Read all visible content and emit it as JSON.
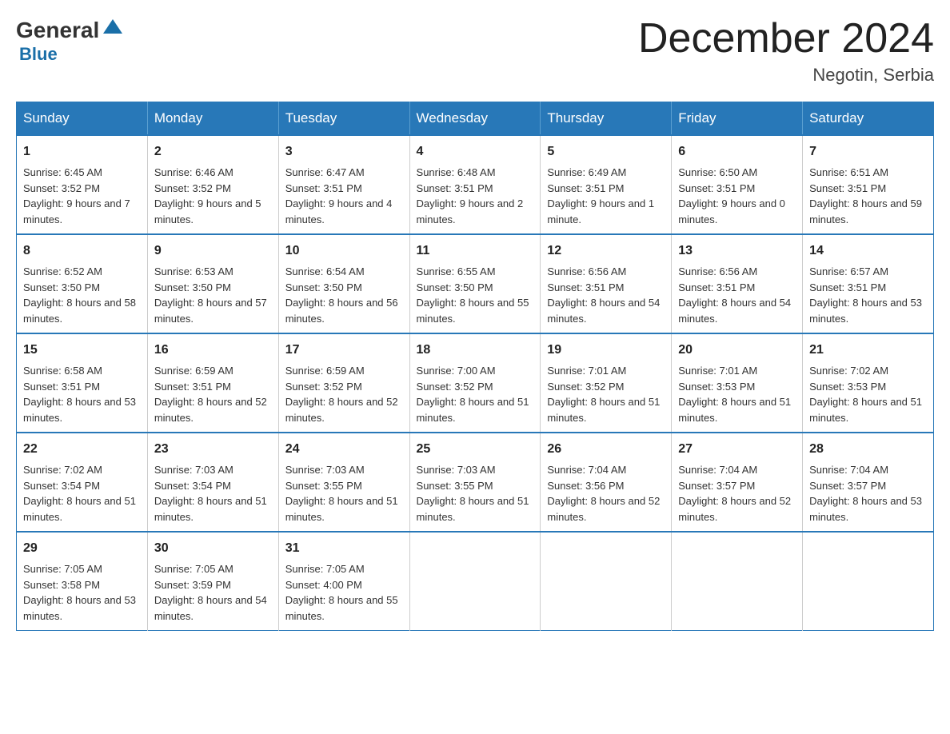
{
  "header": {
    "logo": {
      "general": "General",
      "blue": "Blue"
    },
    "month_title": "December 2024",
    "location": "Negotin, Serbia"
  },
  "days_of_week": [
    "Sunday",
    "Monday",
    "Tuesday",
    "Wednesday",
    "Thursday",
    "Friday",
    "Saturday"
  ],
  "weeks": [
    [
      {
        "day": "1",
        "sunrise": "6:45 AM",
        "sunset": "3:52 PM",
        "daylight": "9 hours and 7 minutes."
      },
      {
        "day": "2",
        "sunrise": "6:46 AM",
        "sunset": "3:52 PM",
        "daylight": "9 hours and 5 minutes."
      },
      {
        "day": "3",
        "sunrise": "6:47 AM",
        "sunset": "3:51 PM",
        "daylight": "9 hours and 4 minutes."
      },
      {
        "day": "4",
        "sunrise": "6:48 AM",
        "sunset": "3:51 PM",
        "daylight": "9 hours and 2 minutes."
      },
      {
        "day": "5",
        "sunrise": "6:49 AM",
        "sunset": "3:51 PM",
        "daylight": "9 hours and 1 minute."
      },
      {
        "day": "6",
        "sunrise": "6:50 AM",
        "sunset": "3:51 PM",
        "daylight": "9 hours and 0 minutes."
      },
      {
        "day": "7",
        "sunrise": "6:51 AM",
        "sunset": "3:51 PM",
        "daylight": "8 hours and 59 minutes."
      }
    ],
    [
      {
        "day": "8",
        "sunrise": "6:52 AM",
        "sunset": "3:50 PM",
        "daylight": "8 hours and 58 minutes."
      },
      {
        "day": "9",
        "sunrise": "6:53 AM",
        "sunset": "3:50 PM",
        "daylight": "8 hours and 57 minutes."
      },
      {
        "day": "10",
        "sunrise": "6:54 AM",
        "sunset": "3:50 PM",
        "daylight": "8 hours and 56 minutes."
      },
      {
        "day": "11",
        "sunrise": "6:55 AM",
        "sunset": "3:50 PM",
        "daylight": "8 hours and 55 minutes."
      },
      {
        "day": "12",
        "sunrise": "6:56 AM",
        "sunset": "3:51 PM",
        "daylight": "8 hours and 54 minutes."
      },
      {
        "day": "13",
        "sunrise": "6:56 AM",
        "sunset": "3:51 PM",
        "daylight": "8 hours and 54 minutes."
      },
      {
        "day": "14",
        "sunrise": "6:57 AM",
        "sunset": "3:51 PM",
        "daylight": "8 hours and 53 minutes."
      }
    ],
    [
      {
        "day": "15",
        "sunrise": "6:58 AM",
        "sunset": "3:51 PM",
        "daylight": "8 hours and 53 minutes."
      },
      {
        "day": "16",
        "sunrise": "6:59 AM",
        "sunset": "3:51 PM",
        "daylight": "8 hours and 52 minutes."
      },
      {
        "day": "17",
        "sunrise": "6:59 AM",
        "sunset": "3:52 PM",
        "daylight": "8 hours and 52 minutes."
      },
      {
        "day": "18",
        "sunrise": "7:00 AM",
        "sunset": "3:52 PM",
        "daylight": "8 hours and 51 minutes."
      },
      {
        "day": "19",
        "sunrise": "7:01 AM",
        "sunset": "3:52 PM",
        "daylight": "8 hours and 51 minutes."
      },
      {
        "day": "20",
        "sunrise": "7:01 AM",
        "sunset": "3:53 PM",
        "daylight": "8 hours and 51 minutes."
      },
      {
        "day": "21",
        "sunrise": "7:02 AM",
        "sunset": "3:53 PM",
        "daylight": "8 hours and 51 minutes."
      }
    ],
    [
      {
        "day": "22",
        "sunrise": "7:02 AM",
        "sunset": "3:54 PM",
        "daylight": "8 hours and 51 minutes."
      },
      {
        "day": "23",
        "sunrise": "7:03 AM",
        "sunset": "3:54 PM",
        "daylight": "8 hours and 51 minutes."
      },
      {
        "day": "24",
        "sunrise": "7:03 AM",
        "sunset": "3:55 PM",
        "daylight": "8 hours and 51 minutes."
      },
      {
        "day": "25",
        "sunrise": "7:03 AM",
        "sunset": "3:55 PM",
        "daylight": "8 hours and 51 minutes."
      },
      {
        "day": "26",
        "sunrise": "7:04 AM",
        "sunset": "3:56 PM",
        "daylight": "8 hours and 52 minutes."
      },
      {
        "day": "27",
        "sunrise": "7:04 AM",
        "sunset": "3:57 PM",
        "daylight": "8 hours and 52 minutes."
      },
      {
        "day": "28",
        "sunrise": "7:04 AM",
        "sunset": "3:57 PM",
        "daylight": "8 hours and 53 minutes."
      }
    ],
    [
      {
        "day": "29",
        "sunrise": "7:05 AM",
        "sunset": "3:58 PM",
        "daylight": "8 hours and 53 minutes."
      },
      {
        "day": "30",
        "sunrise": "7:05 AM",
        "sunset": "3:59 PM",
        "daylight": "8 hours and 54 minutes."
      },
      {
        "day": "31",
        "sunrise": "7:05 AM",
        "sunset": "4:00 PM",
        "daylight": "8 hours and 55 minutes."
      },
      null,
      null,
      null,
      null
    ]
  ]
}
